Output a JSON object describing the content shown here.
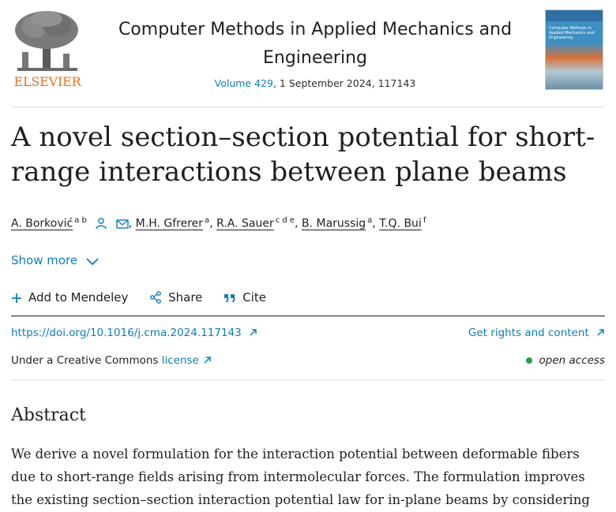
{
  "header": {
    "publisher": "ELSEVIER",
    "journal_title": "Computer Methods in Applied Mechanics and Engineering",
    "volume_link": "Volume 429",
    "issue_details": ", 1 September 2024, 117143",
    "cover_text": "Computer Methods in Applied Mechanics and Engineering"
  },
  "article": {
    "title": "A novel section–section potential for short-range interactions between plane beams",
    "authors": [
      {
        "name": "A. Borković",
        "affil": "a b"
      },
      {
        "name": "M.H. Gfrerer",
        "affil": "a"
      },
      {
        "name": "R.A. Sauer",
        "affil": "c d e"
      },
      {
        "name": "B. Marussig",
        "affil": "a"
      },
      {
        "name": "T.Q. Bui",
        "affil": "f"
      }
    ],
    "show_more": "Show more"
  },
  "actions": {
    "mendeley": "Add to Mendeley",
    "share": "Share",
    "cite": "Cite"
  },
  "links": {
    "doi": "https://doi.org/10.1016/j.cma.2024.117143",
    "rights": "Get rights and content",
    "license_prefix": "Under a Creative Commons ",
    "license_link": "license",
    "access": "open access"
  },
  "abstract": {
    "heading": "Abstract",
    "text": "We derive a novel formulation for the interaction potential between deformable fibers due to short-range fields arising from intermolecular forces. The formulation improves the existing section–section interaction potential law for in-plane beams by considering"
  },
  "colors": {
    "link": "#0c7dbb",
    "brand": "#e9711c",
    "open_access": "#26a33e"
  },
  "icons": [
    "elsevier-tree-logo",
    "person-icon",
    "envelope-icon",
    "chevron-down-icon",
    "plus-icon",
    "share-icon",
    "quote-icon",
    "external-arrow-icon"
  ]
}
